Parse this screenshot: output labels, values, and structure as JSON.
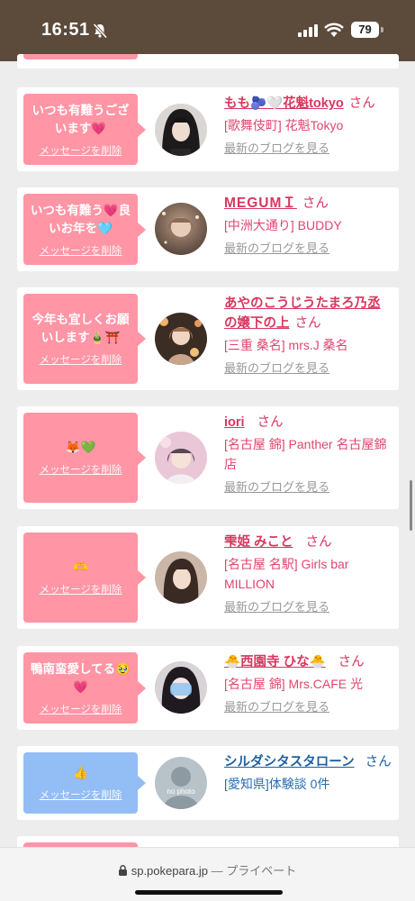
{
  "status_bar": {
    "time": "16:51",
    "battery": "79"
  },
  "browser": {
    "domain": "sp.pokepara.jp",
    "separator": "—",
    "mode": "プライベート"
  },
  "labels": {
    "delete": "メッセージを削除",
    "blog": "最新のブログを見る",
    "san": "さん"
  },
  "colors": {
    "pink_bubble": "#ff95a5",
    "blue_bubble": "#93bdf5",
    "name_pink": "#d8375f",
    "shop_pink": "#e0456f",
    "name_blue": "#1f5f9e",
    "shop_blue": "#2a6db0"
  },
  "cards": [
    {
      "name": "もも🫐🤍花魁tokyo",
      "shop": "[歌舞伎町] 花魁Tokyo",
      "message": "いつも有難うございます💗",
      "blog": true,
      "theme": "pink",
      "avatar": "avatar-1"
    },
    {
      "name": "MEGUMＩ",
      "shop": "[中洲大通り] BUDDY",
      "message": "いつも有難う💗良いお年を🩵",
      "blog": true,
      "theme": "pink",
      "avatar": "avatar-2"
    },
    {
      "name": "あやのこうじうたまろ乃丞の嬢下の上",
      "shop": "[三重 桑名] mrs.J 桑名",
      "message": "今年も宜しくお願いします🎍⛩️",
      "blog": true,
      "theme": "pink",
      "avatar": "avatar-3"
    },
    {
      "name": "iori",
      "shop": "[名古屋 錦] Panther 名古屋錦店",
      "message": "🦊💚",
      "blog": true,
      "theme": "pink",
      "avatar": "avatar-4"
    },
    {
      "name": "雫姫 みこと",
      "shop": "[名古屋 名駅] Girls bar MILLION",
      "message": "🫶",
      "blog": true,
      "theme": "pink",
      "avatar": "avatar-5"
    },
    {
      "name": "🐣西園寺 ひな🐣",
      "shop": "[名古屋 錦] Mrs.CAFE 光",
      "message": "鴨南蛮愛してる🥹💗",
      "blog": true,
      "theme": "pink",
      "avatar": "avatar-6"
    },
    {
      "name": "シルダシタスタローン",
      "shop": "[愛知県]体験談 0件",
      "message": "👍",
      "blog": false,
      "theme": "blue",
      "avatar": "avatar-7",
      "avatar_caption": "no photo"
    }
  ]
}
